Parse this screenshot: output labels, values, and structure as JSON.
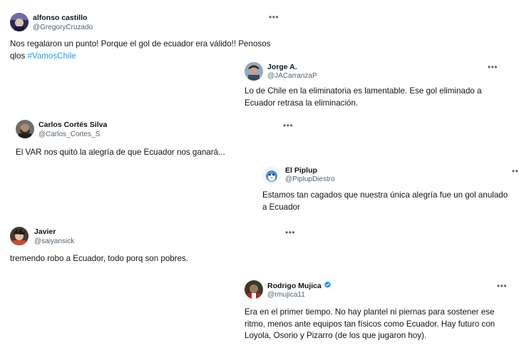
{
  "tweets": [
    {
      "name": "alfonso castillo",
      "handle": "@GregoryCruzado",
      "text": "Nos regalaron un punto! Porque el gol de ecuador era válido!! Penosos",
      "text2": "qlos ",
      "hashtag": "#VamosChile",
      "more": "•••"
    },
    {
      "name": "Jorge A.",
      "handle": "@JACarranzaP",
      "text": "Lo de Chile en la eliminatoria es lamentable. Ese gol eliminado a Ecuador retrasa la eliminación.",
      "more": "•••"
    },
    {
      "name": "Carlos Cortés Silva",
      "handle": "@Carlos_Cortes_S",
      "text": "El VAR nos quitó la alegría de  que Ecuador nos ganará...",
      "more": "•••"
    },
    {
      "name": "El Piplup",
      "handle": "@PiplupDiestro",
      "text": "Estamos tan cagados que nuestra única alegría fue un gol anulado a Ecuador",
      "more": "••"
    },
    {
      "name": "Javier",
      "handle": "@saiyansick",
      "text": "tremendo robo a Ecuador, todo porq son pobres.",
      "more": "•••"
    },
    {
      "name": "Rodrigo Mujica",
      "handle": "@rmujica11",
      "text": "Era en el primer tiempo. No hay plantel ni piernas para sostener ese ritmo, menos ante equipos tan físicos como Ecuador. Hay futuro con Loyola, Osorio y Pizarro (de los que jugaron hoy).",
      "more": "•••",
      "verified_color": "#1d9bf0"
    }
  ]
}
